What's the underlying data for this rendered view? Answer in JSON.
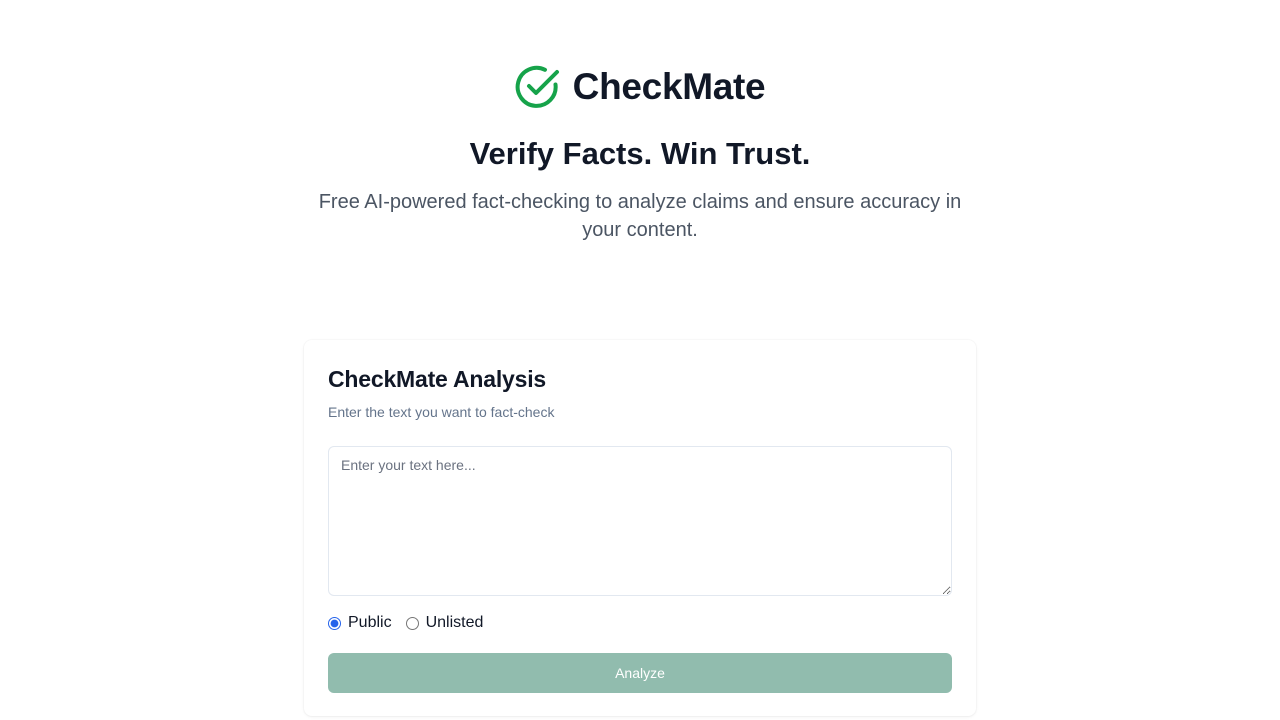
{
  "header": {
    "brand_name": "CheckMate",
    "brand_icon": "check-circle-icon",
    "brand_color": "#16a34a",
    "tagline": "Verify Facts. Win Trust.",
    "subtitle": "Free AI-powered fact-checking to analyze claims and ensure accuracy in your content."
  },
  "analysis_card": {
    "title": "CheckMate Analysis",
    "description": "Enter the text you want to fact-check",
    "input": {
      "value": "",
      "placeholder": "Enter your text here..."
    },
    "visibility_options": [
      {
        "label": "Public",
        "selected": true
      },
      {
        "label": "Unlisted",
        "selected": false
      }
    ],
    "submit_label": "Analyze",
    "submit_color": "#91bcae"
  }
}
